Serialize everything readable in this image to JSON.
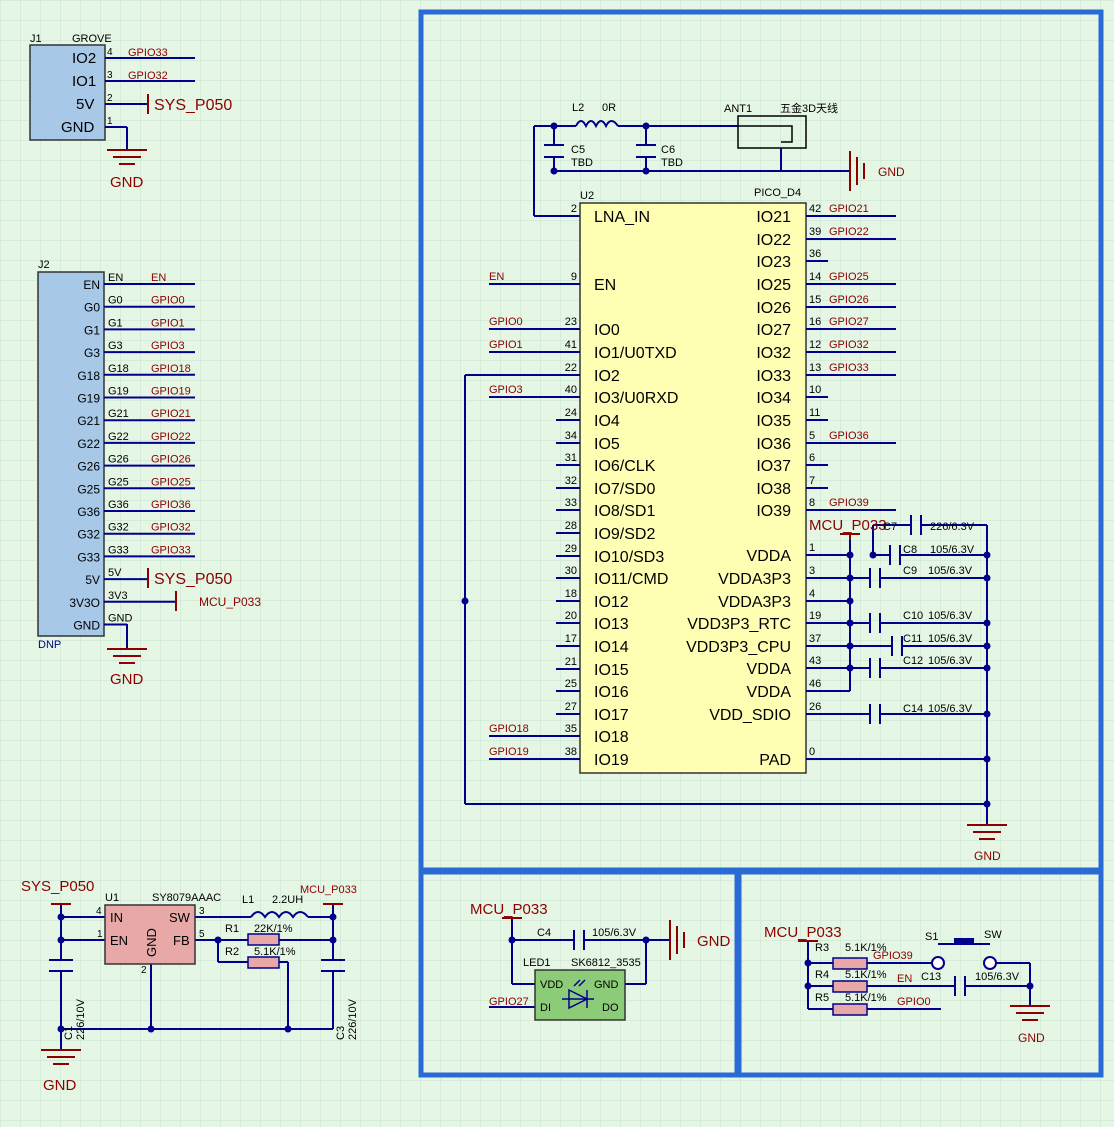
{
  "colors": {
    "wire": "#00008c",
    "net": "#8c0000",
    "component_body": "#a8c8e8",
    "ic_body": "#ffffb4",
    "pmic_body": "#e8a8a8",
    "led_body": "#8ccc78",
    "frame": "#2a6ad4"
  },
  "j1": {
    "ref": "J1",
    "value": "GROVE",
    "pins": [
      {
        "num": "4",
        "name": "IO2",
        "net": "GPIO33"
      },
      {
        "num": "3",
        "name": "IO1",
        "net": "GPIO32"
      },
      {
        "num": "2",
        "name": "5V",
        "net": "SYS_P050"
      },
      {
        "num": "1",
        "name": "GND",
        "net": "GND"
      }
    ]
  },
  "j2": {
    "ref": "J2",
    "footer": "DNP",
    "pins": [
      {
        "name": "EN",
        "num": "EN",
        "net": "EN"
      },
      {
        "name": "G0",
        "num": "G0",
        "net": "GPIO0"
      },
      {
        "name": "G1",
        "num": "G1",
        "net": "GPIO1"
      },
      {
        "name": "G3",
        "num": "G3",
        "net": "GPIO3"
      },
      {
        "name": "G18",
        "num": "G18",
        "net": "GPIO18"
      },
      {
        "name": "G19",
        "num": "G19",
        "net": "GPIO19"
      },
      {
        "name": "G21",
        "num": "G21",
        "net": "GPIO21"
      },
      {
        "name": "G22",
        "num": "G22",
        "net": "GPIO22"
      },
      {
        "name": "G26",
        "num": "G26",
        "net": "GPIO26"
      },
      {
        "name": "G25",
        "num": "G25",
        "net": "GPIO25"
      },
      {
        "name": "G36",
        "num": "G36",
        "net": "GPIO36"
      },
      {
        "name": "G32",
        "num": "G32",
        "net": "GPIO32"
      },
      {
        "name": "G33",
        "num": "G33",
        "net": "GPIO33"
      },
      {
        "name": "5V",
        "num": "5V",
        "net": "SYS_P050"
      },
      {
        "name": "3V3O",
        "num": "3V3",
        "net": "MCU_P033"
      },
      {
        "name": "GND",
        "num": "GND",
        "net": "GND"
      }
    ]
  },
  "rf": {
    "l2_ref": "L2",
    "l2_val": "0R",
    "c5_ref": "C5",
    "c5_val": "TBD",
    "c6_ref": "C6",
    "c6_val": "TBD",
    "ant_ref": "ANT1",
    "ant_val": "五金3D天线",
    "gnd": "GND"
  },
  "u2": {
    "ref": "U2",
    "value": "PICO_D4",
    "left_pins": [
      {
        "num": "2",
        "name": "LNA_IN",
        "net": ""
      },
      {
        "num": "9",
        "name": "EN",
        "net": "EN"
      },
      {
        "num": "23",
        "name": "IO0",
        "net": "GPIO0"
      },
      {
        "num": "41",
        "name": "IO1/U0TXD",
        "net": "GPIO1"
      },
      {
        "num": "22",
        "name": "IO2",
        "net": ""
      },
      {
        "num": "40",
        "name": "IO3/U0RXD",
        "net": "GPIO3"
      },
      {
        "num": "24",
        "name": "IO4",
        "net": ""
      },
      {
        "num": "34",
        "name": "IO5",
        "net": ""
      },
      {
        "num": "31",
        "name": "IO6/CLK",
        "net": ""
      },
      {
        "num": "32",
        "name": "IO7/SD0",
        "net": ""
      },
      {
        "num": "33",
        "name": "IO8/SD1",
        "net": ""
      },
      {
        "num": "28",
        "name": "IO9/SD2",
        "net": ""
      },
      {
        "num": "29",
        "name": "IO10/SD3",
        "net": ""
      },
      {
        "num": "30",
        "name": "IO11/CMD",
        "net": ""
      },
      {
        "num": "18",
        "name": "IO12",
        "net": ""
      },
      {
        "num": "20",
        "name": "IO13",
        "net": ""
      },
      {
        "num": "17",
        "name": "IO14",
        "net": ""
      },
      {
        "num": "21",
        "name": "IO15",
        "net": ""
      },
      {
        "num": "25",
        "name": "IO16",
        "net": ""
      },
      {
        "num": "27",
        "name": "IO17",
        "net": ""
      },
      {
        "num": "35",
        "name": "IO18",
        "net": "GPIO18"
      },
      {
        "num": "38",
        "name": "IO19",
        "net": "GPIO19"
      }
    ],
    "right_pins": [
      {
        "num": "42",
        "name": "IO21",
        "net": "GPIO21"
      },
      {
        "num": "39",
        "name": "IO22",
        "net": "GPIO22"
      },
      {
        "num": "36",
        "name": "IO23",
        "net": ""
      },
      {
        "num": "14",
        "name": "IO25",
        "net": "GPIO25"
      },
      {
        "num": "15",
        "name": "IO26",
        "net": "GPIO26"
      },
      {
        "num": "16",
        "name": "IO27",
        "net": "GPIO27"
      },
      {
        "num": "12",
        "name": "IO32",
        "net": "GPIO32"
      },
      {
        "num": "13",
        "name": "IO33",
        "net": "GPIO33"
      },
      {
        "num": "10",
        "name": "IO34",
        "net": ""
      },
      {
        "num": "11",
        "name": "IO35",
        "net": ""
      },
      {
        "num": "5",
        "name": "IO36",
        "net": "GPIO36"
      },
      {
        "num": "6",
        "name": "IO37",
        "net": ""
      },
      {
        "num": "7",
        "name": "IO38",
        "net": ""
      },
      {
        "num": "8",
        "name": "IO39",
        "net": "GPIO39"
      },
      {
        "num": "1",
        "name": "VDDA",
        "net": ""
      },
      {
        "num": "3",
        "name": "VDDA3P3",
        "net": ""
      },
      {
        "num": "4",
        "name": "VDDA3P3",
        "net": ""
      },
      {
        "num": "19",
        "name": "VDD3P3_RTC",
        "net": ""
      },
      {
        "num": "37",
        "name": "VDD3P3_CPU",
        "net": ""
      },
      {
        "num": "43",
        "name": "VDDA",
        "net": ""
      },
      {
        "num": "46",
        "name": "VDDA",
        "net": ""
      },
      {
        "num": "26",
        "name": "VDD_SDIO",
        "net": ""
      },
      {
        "num": "0",
        "name": "PAD",
        "net": ""
      }
    ],
    "caps": [
      {
        "ref": "C7",
        "val": "226/6.3V"
      },
      {
        "ref": "C8",
        "val": "105/6.3V"
      },
      {
        "ref": "C9",
        "val": "105/6.3V"
      },
      {
        "ref": "C10",
        "val": "105/6.3V"
      },
      {
        "ref": "C11",
        "val": "105/6.3V"
      },
      {
        "ref": "C12",
        "val": "105/6.3V"
      },
      {
        "ref": "C14",
        "val": "105/6.3V"
      }
    ],
    "supply": "MCU_P033",
    "gnd": "GND"
  },
  "pwr": {
    "in_net": "SYS_P050",
    "out_net": "MCU_P033",
    "u1_ref": "U1",
    "u1_val": "SY8079AAAC",
    "u1_pins": {
      "in": "IN",
      "en": "EN",
      "sw": "SW",
      "fb": "FB",
      "gnd": "GND",
      "n_in": "4",
      "n_en": "1",
      "n_sw": "3",
      "n_fb": "5",
      "n_gnd": "2"
    },
    "l1_ref": "L1",
    "l1_val": "2.2UH",
    "r1_ref": "R1",
    "r1_val": "22K/1%",
    "r2_ref": "R2",
    "r2_val": "5.1K/1%",
    "c1_ref": "C1",
    "c1_val": "226/10V",
    "c3_ref": "C3",
    "c3_val": "226/10V",
    "gnd": "GND"
  },
  "led": {
    "supply": "MCU_P033",
    "c4_ref": "C4",
    "c4_val": "105/6.3V",
    "gnd": "GND",
    "ref": "LED1",
    "val": "SK6812_3535",
    "vdd": "VDD",
    "gndpin": "GND",
    "di": "DI",
    "do": "DO",
    "din_net": "GPIO27"
  },
  "btn": {
    "supply": "MCU_P033",
    "r3_ref": "R3",
    "r3_val": "5.1K/1%",
    "r3_net": "GPIO39",
    "r4_ref": "R4",
    "r4_val": "5.1K/1%",
    "r4_net": "EN",
    "r5_ref": "R5",
    "r5_val": "5.1K/1%",
    "r5_net": "GPIO0",
    "s_ref": "S1",
    "s_val": "SW",
    "c13_ref": "C13",
    "c13_val": "105/6.3V",
    "gnd": "GND"
  }
}
